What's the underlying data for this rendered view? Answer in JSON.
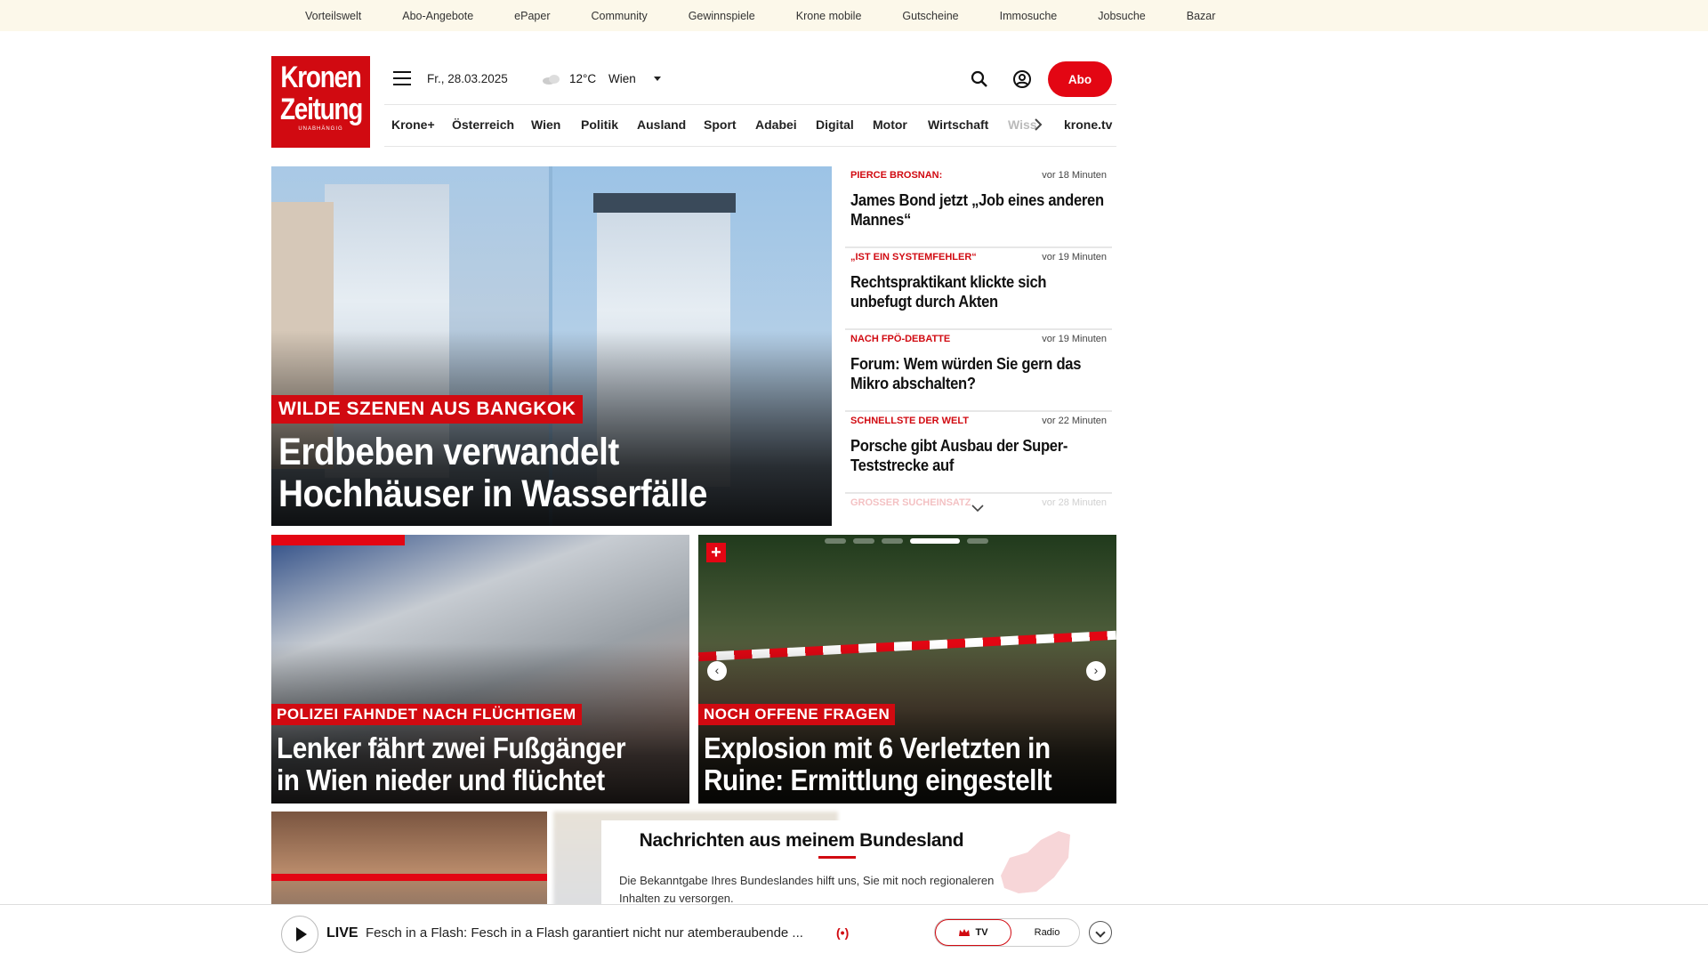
{
  "topbar": {
    "links": [
      "Vorteilswelt",
      "Abo-Angebote",
      "ePaper",
      "Community",
      "Gewinnspiele",
      "Krone mobile",
      "Gutscheine",
      "Immosuche",
      "Jobsuche",
      "Bazar"
    ]
  },
  "logo": {
    "line1": "Kronen",
    "line2": "Zeitung",
    "line3": "UNABHÄNGIG"
  },
  "header": {
    "date": "Fr., 28.03.2025",
    "temperature": "12°C",
    "city": "Wien",
    "abo": "Abo"
  },
  "nav": {
    "items": [
      "Krone+",
      "Österreich",
      "Wien",
      "Politik",
      "Ausland",
      "Sport",
      "Adabei",
      "Digital",
      "Motor",
      "Wirtschaft",
      "Wiss"
    ],
    "tv": "krone.tv"
  },
  "hero": {
    "tag": "WILDE SZENEN AUS BANGKOK",
    "line1": "Erdbeben verwandelt",
    "line2": "Hochhäuser in Wasserfälle"
  },
  "sidebar": [
    {
      "kicker": "PIERCE BROSNAN:",
      "time": "vor 18 Minuten",
      "title": "James Bond jetzt „Job eines anderen Mannes“"
    },
    {
      "kicker": "„IST EIN SYSTEMFEHLER“",
      "time": "vor 19 Minuten",
      "title": "Rechtspraktikant klickte sich unbefugt durch Akten"
    },
    {
      "kicker": "NACH FPÖ-DEBATTE",
      "time": "vor 19 Minuten",
      "title": "Forum: Wem würden Sie gern das Mikro abschalten?"
    },
    {
      "kicker": "SCHNELLSTE DER WELT",
      "time": "vor 22 Minuten",
      "title": "Porsche gibt Ausbau der Super-Teststrecke auf"
    },
    {
      "kicker": "GROSSER SUCHEINSATZ",
      "time": "vor 28 Minuten",
      "title": ""
    }
  ],
  "cards": [
    {
      "tag": "POLIZEI FAHNDET NACH FLÜCHTIGEM",
      "line1": "Lenker fährt zwei Fußgänger",
      "line2": "in Wien nieder und flüchtet"
    },
    {
      "tag": "NOCH OFFENE FRAGEN",
      "line1": "Explosion mit 6 Verletzten in",
      "line2": "Ruine: Ermittlung eingestellt",
      "plus": "+"
    }
  ],
  "bundesland": {
    "heading": "Nachrichten aus meinem Bundesland",
    "text": "Die Bekanntgabe Ihres Bundeslandes hilft uns, Sie mit noch regionaleren Inhalten zu versorgen."
  },
  "player": {
    "live": "LIVE",
    "title": "Fesch in a Flash: Fesch in a Flash garantiert nicht nur atemberaubende ...",
    "radio_icon": "(•)",
    "tv": "TV",
    "radio": "Radio"
  },
  "colors": {
    "brand": "#d10a11",
    "accent": "#e30613",
    "topbar": "#fcf8ea"
  }
}
